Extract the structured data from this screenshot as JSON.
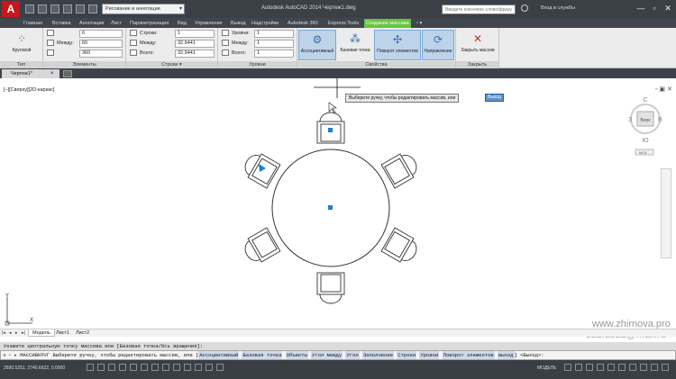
{
  "titlebar": {
    "workspace": "Рисование и аннотации",
    "title": "Autodesk AutoCAD 2014   Чертеж1.dwg",
    "search_placeholder": "Введите ключевое слово/фразу",
    "signin": "Вход в службы",
    "app_icon": "A",
    "min": "—",
    "max": "▫",
    "close": "✕"
  },
  "tabs": [
    {
      "label": "Главная"
    },
    {
      "label": "Вставка"
    },
    {
      "label": "Аннотации"
    },
    {
      "label": "Лист"
    },
    {
      "label": "Параметризация"
    },
    {
      "label": "Вид"
    },
    {
      "label": "Управление"
    },
    {
      "label": "Вывод"
    },
    {
      "label": "Надстройки"
    },
    {
      "label": "Autodesk 360"
    },
    {
      "label": "Express Tools"
    },
    {
      "label": "Создание массива"
    }
  ],
  "ribbon": {
    "type_panel": {
      "title": "Тип",
      "button": "Круговой"
    },
    "elements_panel": {
      "title": "Элементы",
      "rows": [
        {
          "label": "",
          "value": "6"
        },
        {
          "label": "Между:",
          "value": "60"
        },
        {
          "label": "",
          "value": "360"
        }
      ]
    },
    "rows_panel": {
      "title": "Строки ▾",
      "rows": [
        {
          "label": "Строки:",
          "value": "1"
        },
        {
          "label": "Между:",
          "value": "32.9441"
        },
        {
          "label": "Всего:",
          "value": "32.9441"
        }
      ]
    },
    "levels_panel": {
      "title": "Уровни",
      "rows": [
        {
          "label": "Уровни:",
          "value": "1"
        },
        {
          "label": "Между:",
          "value": "1"
        },
        {
          "label": "Всего:",
          "value": "1"
        }
      ]
    },
    "props_panel": {
      "title": "Свойства",
      "buttons": [
        {
          "label": "Ассоциативный"
        },
        {
          "label": "Базовая точка"
        },
        {
          "label": "Поворот элементов"
        },
        {
          "label": "Направление"
        }
      ]
    },
    "close_panel": {
      "title": "Закрыть",
      "button": "Закрыть массив"
    }
  },
  "file_tab": {
    "label": "Чертеж1*",
    "close": "×"
  },
  "drawing": {
    "viewport_label": "[–][Сверху][2D-каркас]",
    "tooltip": "Выберите ручку, чтобы редактировать массив, или",
    "tooltip_input": "Выход",
    "viewcube": {
      "top_face": "Верх",
      "north": "С",
      "south": "Ю",
      "west": "З",
      "east": "В",
      "wcs": "МСК"
    },
    "ucs_y": "Y",
    "ucs_x": "X",
    "watermark_url": "www.zhirnova.pro",
    "watermark_mail": "cad.acad@mail.ru",
    "mini_controls": "▫ ▣ ✕"
  },
  "layout_tabs": [
    {
      "label": "Модель"
    },
    {
      "label": "Лист1"
    },
    {
      "label": "Лист2"
    }
  ],
  "command": {
    "history": "Укажите центральную точку массива или [Базовая точка/Ось вращения]:",
    "close_glyph": "✕",
    "prompt": "▫ ▸ МАССИВКРУГ Выберите ручку, чтобы редактировать массив, или [",
    "options": [
      "Ассоциативный",
      "Базовая точка",
      "Объекты",
      "Угол между",
      "Угол",
      "Заполнение",
      "Строки",
      "Уровни",
      "Поворот элементов",
      "выход"
    ],
    "suffix": "] <Выход>:"
  },
  "statusbar": {
    "coords": "2690.5251, 2740.6622, 0.0000",
    "model": "МОДЕЛЬ"
  }
}
